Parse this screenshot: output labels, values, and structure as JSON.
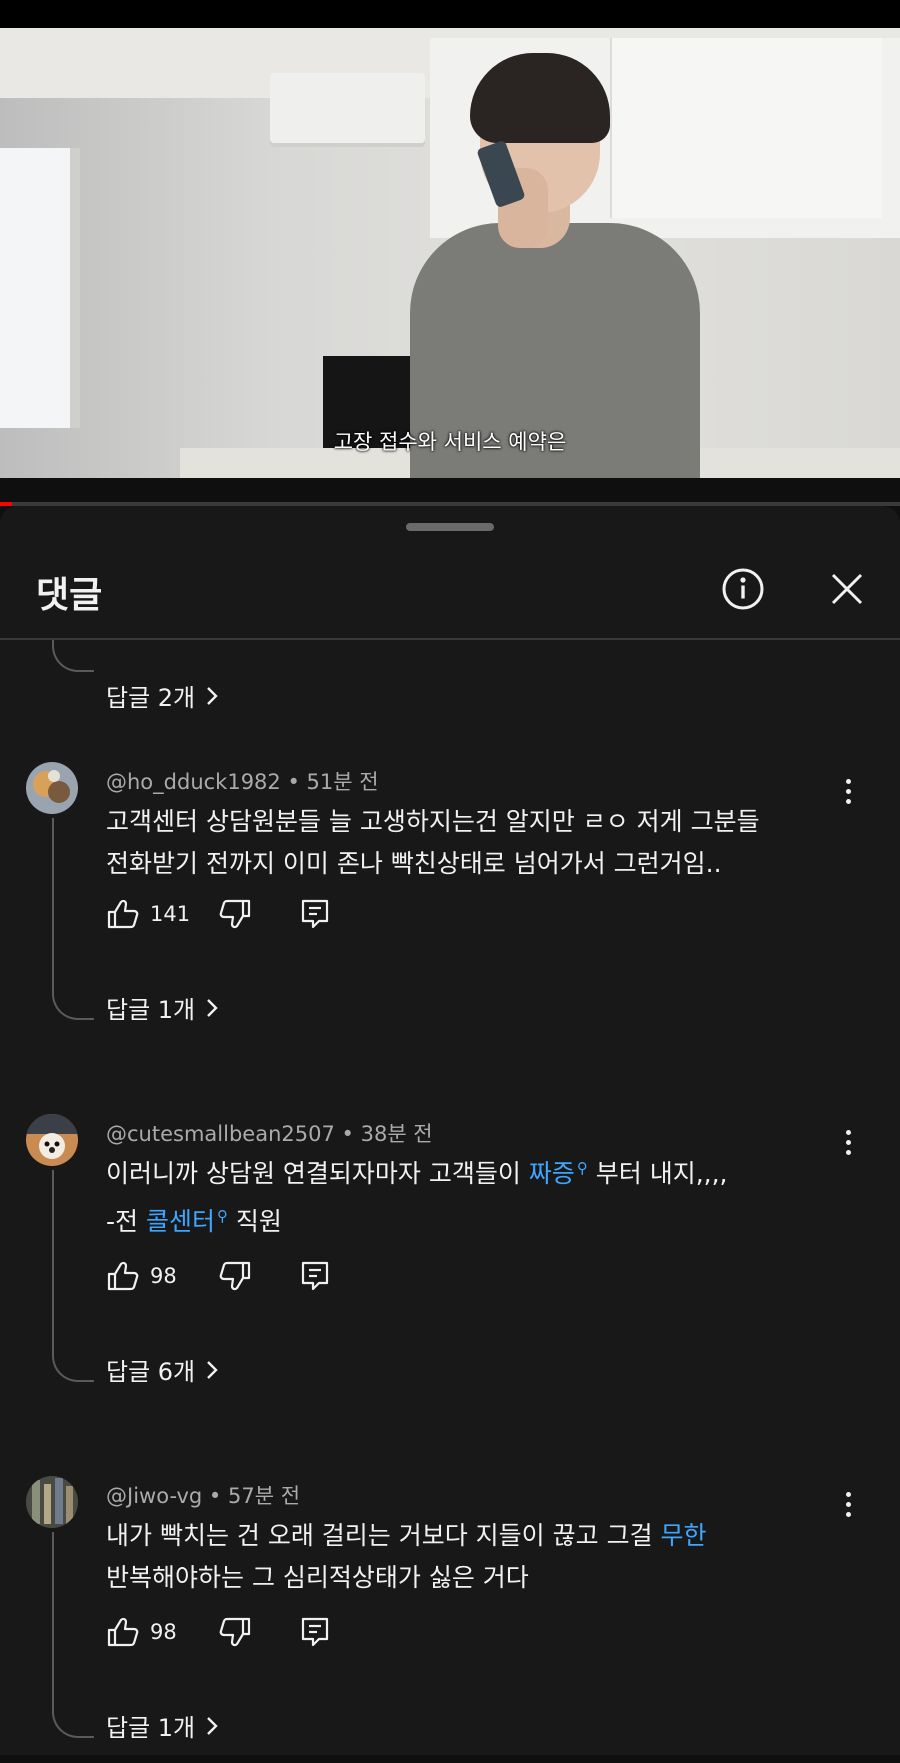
{
  "video": {
    "subtitle": "고장 접수와 서비스 예약은",
    "progress_fraction": 0.013
  },
  "panel": {
    "title": "댓글",
    "info_icon": "info-circle-icon",
    "close_icon": "close-icon"
  },
  "partial_thread": {
    "replies_label": "답글 2개"
  },
  "comments": [
    {
      "author": "@ho_dduck1982",
      "time": "51분 전",
      "lines": [
        "고객센터 상담원분들 늘 고생하지는건 알지만 ㄹㅇ 저게 그분들",
        "전화받기 전까지 이미 존나 빡친상태로 넘어가서 그런거임.."
      ],
      "likes": "141",
      "replies_label": "답글 1개"
    },
    {
      "author": "@cutesmallbean2507",
      "time": "38분 전",
      "line1_before": "이러니까 상담원 연결되자마자 고객들이 ",
      "line1_link": "짜증",
      "line1_after": " 부터 내지,,,,",
      "line2_before": "-전 ",
      "line2_link": "콜센터",
      "line2_after": " 직원",
      "likes": "98",
      "replies_label": "답글 6개"
    },
    {
      "author": "@Jiwo-vg",
      "time": "57분 전",
      "line1_before": "내가 빡치는 건 오래 걸리는 거보다 지들이 끊고 그걸 ",
      "line1_link": "무한",
      "line2": "반복해야하는 그 심리적상태가 싫은 거다",
      "likes": "98",
      "replies_label": "답글 1개"
    }
  ],
  "separator": "•"
}
